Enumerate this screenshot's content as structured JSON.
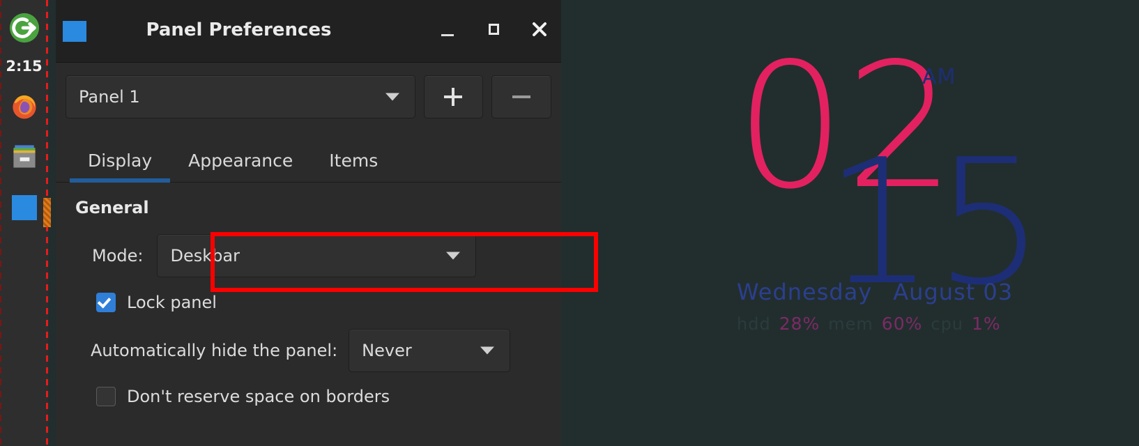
{
  "deskbar": {
    "clock": "2:15",
    "items": [
      {
        "name": "logout-icon",
        "label": "Log Out"
      },
      {
        "name": "clock",
        "label": "2:15"
      },
      {
        "name": "firefox-icon",
        "label": "Firefox"
      },
      {
        "name": "file-manager-icon",
        "label": "File Manager"
      },
      {
        "name": "blue-app-icon",
        "label": "Application"
      }
    ]
  },
  "window": {
    "title": "Panel Preferences",
    "titlebar_buttons": {
      "minimize": "_",
      "maximize": "□",
      "close": "×"
    },
    "panel_selector": {
      "value": "Panel 1",
      "add_label": "+",
      "remove_label": "−"
    },
    "tabs": [
      {
        "label": "Display",
        "active": true
      },
      {
        "label": "Appearance",
        "active": false
      },
      {
        "label": "Items",
        "active": false
      }
    ],
    "general": {
      "heading": "General",
      "mode_label": "Mode:",
      "mode_value": "Deskbar",
      "lock_panel_label": "Lock panel",
      "lock_panel_checked": true,
      "autohide_label": "Automatically hide the panel:",
      "autohide_value": "Never",
      "reserve_label": "Don't reserve space on borders",
      "reserve_checked": false
    }
  },
  "desktop": {
    "conky": {
      "hour": "02",
      "minute": "15",
      "ampm": "AM",
      "weekday": "Wednesday",
      "date": "August 03",
      "stats": {
        "hdd_label": "hdd",
        "hdd_value": "28%",
        "mem_label": "mem",
        "mem_value": "60%",
        "cpu_label": "cpu",
        "cpu_value": "1%"
      }
    }
  },
  "colors": {
    "accent_blue": "#215d9c",
    "highlight_red": "#fc0000",
    "clock_pink": "#e32160",
    "clock_blue": "#1d2e77",
    "desktop_bg": "#222e2e",
    "window_bg": "#2b2b2b"
  }
}
